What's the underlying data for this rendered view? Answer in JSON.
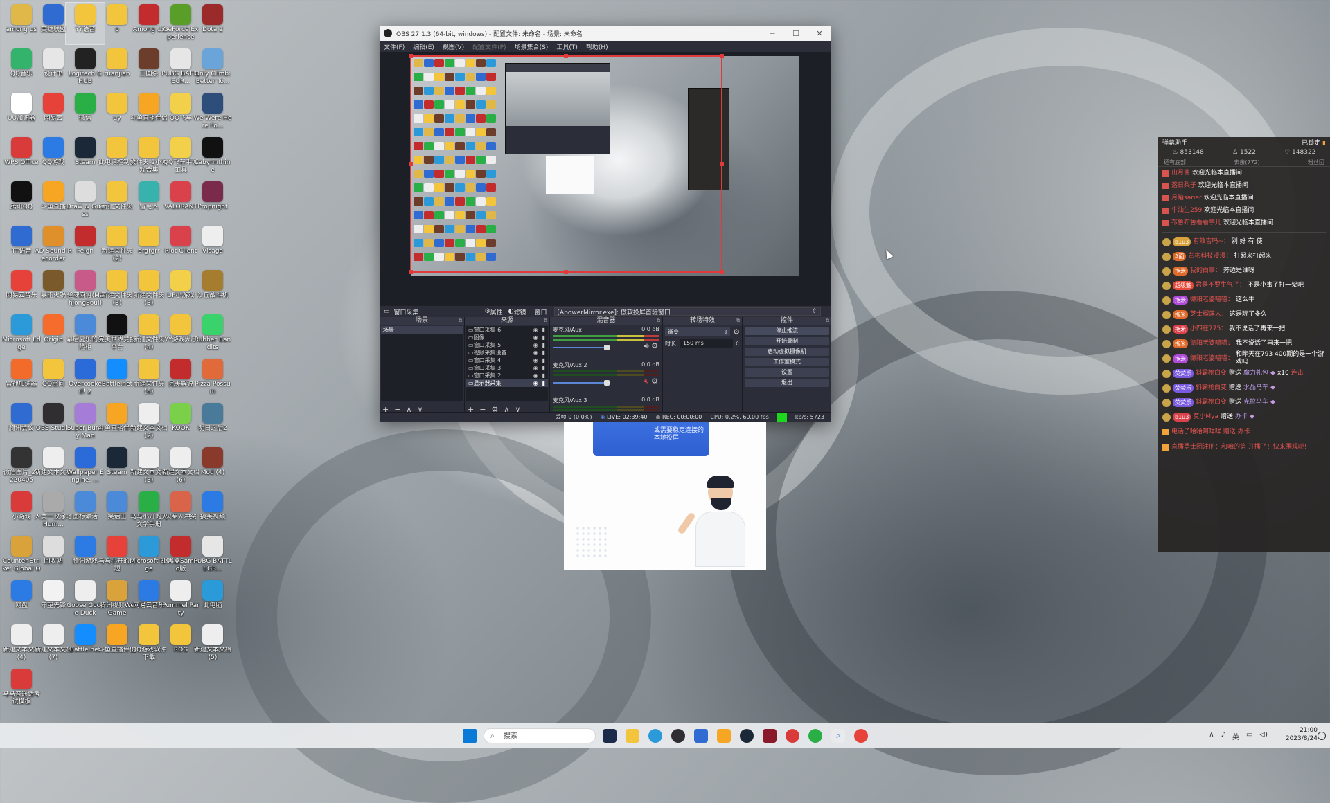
{
  "desktop": {
    "icons": [
      {
        "label": "among us",
        "color": "#e0b84a"
      },
      {
        "label": "英雄联盟",
        "color": "#2f6bd0"
      },
      {
        "label": "YY语音",
        "color": "#f2c53d"
      },
      {
        "label": "o",
        "color": "#f2c53d"
      },
      {
        "label": "Among Us",
        "color": "#c32c2c"
      },
      {
        "label": "GeForce Experience",
        "color": "#5a9e2a"
      },
      {
        "label": "Dota 2",
        "color": "#9b2b2b"
      },
      {
        "label": "QQ音乐",
        "color": "#33b36b"
      },
      {
        "label": "设计书",
        "color": "#e6e6e6"
      },
      {
        "label": "Logitech G HUB",
        "color": "#222222"
      },
      {
        "label": "ruanjian",
        "color": "#f2c53d"
      },
      {
        "label": "三国杀",
        "color": "#6b3d2a"
      },
      {
        "label": "PUBG BATTLEGR...",
        "color": "#e6e6e6"
      },
      {
        "label": "Only Climb: Better To...",
        "color": "#6aa4d8"
      },
      {
        "label": "UU加速器",
        "color": "#ffffff"
      },
      {
        "label": "网易云",
        "color": "#e6423a"
      },
      {
        "label": "微信",
        "color": "#2aae46"
      },
      {
        "label": "uy",
        "color": "#f2c53d"
      },
      {
        "label": "斗鱼直播伴侣",
        "color": "#f6a623"
      },
      {
        "label": "QQ飞车",
        "color": "#f2d04a"
      },
      {
        "label": "We Were Here Fo...",
        "color": "#2d4d7a"
      },
      {
        "label": "WPS Office",
        "color": "#d93b3b"
      },
      {
        "label": "QQ游戏",
        "color": "#2c7be5"
      },
      {
        "label": "Steam",
        "color": "#1b2838"
      },
      {
        "label": "此电脑控制器",
        "color": "#f2c53d"
      },
      {
        "label": "文件夹-2小游戏合集",
        "color": "#f2c53d"
      },
      {
        "label": "QQ飞车手游工具",
        "color": "#f2d04a"
      },
      {
        "label": "Labyrinthine",
        "color": "#111111"
      },
      {
        "label": "腾讯QQ",
        "color": "#111111"
      },
      {
        "label": "斗鱼直播",
        "color": "#f6a623"
      },
      {
        "label": "Draw & Guess",
        "color": "#dddddd"
      },
      {
        "label": "新建文件夹",
        "color": "#f2c53d"
      },
      {
        "label": "雷电入",
        "color": "#38b2ac"
      },
      {
        "label": "VALORANT",
        "color": "#d9414b"
      },
      {
        "label": "Propnight",
        "color": "#7a2a4a"
      },
      {
        "label": "TT语音",
        "color": "#2f6bd0"
      },
      {
        "label": "AD Sound Recorder",
        "color": "#e0902a"
      },
      {
        "label": "Feign",
        "color": "#c32c2c"
      },
      {
        "label": "新建文件夹 (2)",
        "color": "#f2c53d"
      },
      {
        "label": "ergrgrr",
        "color": "#f2c53d"
      },
      {
        "label": "Riot Client",
        "color": "#d9414b"
      },
      {
        "label": "Visage",
        "color": "#eeeeee"
      },
      {
        "label": "网易云音乐",
        "color": "#e6423a"
      },
      {
        "label": "暴雨火锅",
        "color": "#7a5a2a"
      },
      {
        "label": "雀魂麻将(MahjongSoul)",
        "color": "#c85a8a"
      },
      {
        "label": "新建文件夹 (3)",
        "color": "#f2c53d"
      },
      {
        "label": "新建文件夹 (3)",
        "color": "#f2c53d"
      },
      {
        "label": "UP小游戏",
        "color": "#f2d04a"
      },
      {
        "label": "沙丘战斗机",
        "color": "#a67c2e"
      },
      {
        "label": "Microsoft Edge",
        "color": "#2c9ad9"
      },
      {
        "label": "Origin",
        "color": "#f56c2d"
      },
      {
        "label": "幕后夏乐的保险柜",
        "color": "#4a8ad9"
      },
      {
        "label": "完美世界竞技平台",
        "color": "#111111"
      },
      {
        "label": "新建文件夹 (4)",
        "color": "#f2c53d"
      },
      {
        "label": "YY游戏大厅",
        "color": "#f2c53d"
      },
      {
        "label": "Rubber Bandits",
        "color": "#3ad36b"
      },
      {
        "label": "雷神加速器",
        "color": "#f26b2a"
      },
      {
        "label": "QQ空间",
        "color": "#f2c53d"
      },
      {
        "label": "Overcooked! 2",
        "color": "#2a6ad9"
      },
      {
        "label": "Battle.net",
        "color": "#148eff"
      },
      {
        "label": "新建文件夹 (6)",
        "color": "#f2c53d"
      },
      {
        "label": "完美解说",
        "color": "#c32c2c"
      },
      {
        "label": "Pizza Possum",
        "color": "#e06a3a"
      },
      {
        "label": "腾讯会议",
        "color": "#2f6bd0"
      },
      {
        "label": "OBS Studio",
        "color": "#302e31"
      },
      {
        "label": "Super Bunny Man",
        "color": "#a67cd9"
      },
      {
        "label": "斗鱼直播伴侣",
        "color": "#f6a623"
      },
      {
        "label": "新建文本文档 (2)",
        "color": "#eeeeee"
      },
      {
        "label": "KOOK",
        "color": "#7bd04a"
      },
      {
        "label": "明日之后2",
        "color": "#4a7a9a"
      },
      {
        "label": "微信图片_20220405",
        "color": "#333333"
      },
      {
        "label": "新建文本文档",
        "color": "#eeeeee"
      },
      {
        "label": "Wallpaper Engine: ...",
        "color": "#2a6ad9"
      },
      {
        "label": "Steam",
        "color": "#1b2838"
      },
      {
        "label": "新建文本文档 (3)",
        "color": "#eeeeee"
      },
      {
        "label": "新建文本文档 (6)",
        "color": "#eeeeee"
      },
      {
        "label": "Mod (4)",
        "color": "#8a3a2a"
      },
      {
        "label": "小游戏",
        "color": "#d93b3b"
      },
      {
        "label": "人类一败涂地 Hum...",
        "color": "#aaaaaa"
      },
      {
        "label": "图标激活",
        "color": "#4a8ad9"
      },
      {
        "label": "笑话王",
        "color": "#4a8ad9"
      },
      {
        "label": "马马小开的天文学手册",
        "color": "#2aae46"
      },
      {
        "label": "火柴人冲突",
        "color": "#d9644a"
      },
      {
        "label": "搞笑视频",
        "color": "#2c7be5"
      },
      {
        "label": "Counter-Strike: Global Off...",
        "color": "#d9a23a"
      },
      {
        "label": "回收站",
        "color": "#dddddd"
      },
      {
        "label": "腾讯游戏",
        "color": "#2c7be5"
      },
      {
        "label": "马马小开的问题",
        "color": "#e6423a"
      },
      {
        "label": "Microsoft Edge",
        "color": "#2c9ad9"
      },
      {
        "label": "小黑盒SamPro版",
        "color": "#c32c2c"
      },
      {
        "label": "PUBG BATTLEGR...",
        "color": "#e6e6e6"
      },
      {
        "label": "网盘",
        "color": "#2c7be5"
      },
      {
        "label": "守望先锋",
        "color": "#f2f2f2"
      },
      {
        "label": "Goose Goose Duck",
        "color": "#eeeeee"
      },
      {
        "label": "腾讯视频WeGame",
        "color": "#d9a23a"
      },
      {
        "label": "网易云音乐",
        "color": "#2c7be5"
      },
      {
        "label": "Pummel Party",
        "color": "#eeeeee"
      },
      {
        "label": "此电脑",
        "color": "#2a9ad9"
      },
      {
        "label": "新建文本文档 (4)",
        "color": "#eeeeee"
      },
      {
        "label": "新建文本文档 (7)",
        "color": "#eeeeee"
      },
      {
        "label": "Battle.net",
        "color": "#148eff"
      },
      {
        "label": "斗鱼直播伴侣",
        "color": "#f6a623"
      },
      {
        "label": "QQ游戏软件下载",
        "color": "#f2c53d"
      },
      {
        "label": "ROG",
        "color": "#f2c53d"
      },
      {
        "label": "新建文本文档 (5)",
        "color": "#eeeeee"
      },
      {
        "label": "马马普通话考试模板",
        "color": "#d93b3b"
      }
    ]
  },
  "obs": {
    "title": "OBS 27.1.3 (64-bit, windows) - 配置文件: 未命名 - 场景: 未命名",
    "menu": [
      "文件(F)",
      "编辑(E)",
      "视图(V)",
      "配置文件(P)",
      "场景集合(S)",
      "工具(T)",
      "帮助(H)"
    ],
    "source_toolbar": {
      "current": "窗口采集",
      "properties": "属性",
      "filters": "滤镜",
      "window_label": "窗口",
      "window_value": "[ApowerMirror.exe]: 傲软投屏首验窗口"
    },
    "docks": {
      "scenes": {
        "title": "场景",
        "items": [
          "场景"
        ]
      },
      "sources": {
        "title": "来源",
        "items": [
          "窗口采集 6",
          "图像",
          "窗口采集 5",
          "视频采集设备",
          "窗口采集 4",
          "窗口采集 3",
          "窗口采集 2",
          "显示器采集"
        ]
      },
      "mixer": {
        "title": "混音器",
        "channels": [
          {
            "name": "麦克风/Aux",
            "db": "0.0 dB",
            "level": 0.78,
            "muted": false
          },
          {
            "name": "麦克风/Aux 2",
            "db": "0.0 dB",
            "level": 0.78,
            "muted": true
          },
          {
            "name": "麦克风/Aux 3",
            "db": "0.0 dB",
            "level": 0.78,
            "muted": true
          }
        ]
      },
      "transitions": {
        "title": "转场特效",
        "type": "渐变",
        "duration_label": "时长",
        "duration": "150 ms"
      },
      "controls": {
        "title": "控件",
        "buttons": [
          "停止推流",
          "开始录制",
          "启动虚拟摄像机",
          "工作室模式",
          "设置",
          "退出"
        ]
      }
    },
    "status": {
      "dropped": "丢帧 0 (0.0%)",
      "live": "LIVE: 02:39:40",
      "rec": "REC: 00:00:00",
      "cpu": "CPU: 0.2%, 60.00 fps",
      "kbps": "kb/s: 5723"
    }
  },
  "floating_image": {
    "banner_text": "或需要稳定连接的本地投屏"
  },
  "danmu": {
    "title": "弹幕助手",
    "lock": "已锁定",
    "stats": [
      "853148",
      "1522",
      "148322"
    ],
    "tabs": [
      "还有底部",
      "表亲(772)",
      "粉丝团"
    ],
    "welcome": [
      {
        "user": "山月酱",
        "text": "欢迎光临本直播间"
      },
      {
        "user": "落日梨子",
        "text": "欢迎光临本直播间"
      },
      {
        "user": "月踏sarier",
        "text": "欢迎光临本直播间"
      },
      {
        "user": "牛油生259",
        "text": "欢迎光临本直播间"
      },
      {
        "user": "布鲁布鲁看看事儿",
        "text": "欢迎光临本直播间"
      }
    ],
    "messages": [
      {
        "badge": "b1u3",
        "badge_color": "#d9a23a",
        "user": "有效吉吗~：",
        "text": "别 好 有 使"
      },
      {
        "badge": "A面",
        "badge_color": "#e06a2a",
        "user": "彭彬科技漫漫：",
        "text": "打起来打起来"
      },
      {
        "badge": "拖米",
        "badge_color": "#e06a2a",
        "user": "我的白事：",
        "text": "旁边是谁呀"
      },
      {
        "badge": "超级魅",
        "badge_color": "#e64a3a",
        "user": "君是不要生气了：",
        "text": "不是小事了打一架吧"
      },
      {
        "badge": "拖米",
        "badge_color": "#b04ad9",
        "user": "德阳老婆喵喵：",
        "text": "这么牛"
      },
      {
        "badge": "拖米",
        "badge_color": "#e06a2a",
        "user": "芝士榴莲人：",
        "text": "这是玩了多久"
      },
      {
        "badge": "拖米",
        "badge_color": "#d9414b",
        "user": "小四在775：",
        "text": "我不说话了再来一把"
      },
      {
        "badge": "拖米",
        "badge_color": "#e06a2a",
        "user": "德阳老婆喵喵：",
        "text": "我不说话了再来一把"
      },
      {
        "badge": "拖米",
        "badge_color": "#b04ad9",
        "user": "德阳老婆喵喵：",
        "text": "和昨天在793 400期的是一个游戏吗"
      }
    ],
    "gifts": [
      {
        "badge": "荧荧乐",
        "user": "斜霸枪白变",
        "action": "赠送",
        "item": "魔力礼包",
        "count": "x10",
        "extra": "连击"
      },
      {
        "badge": "荧荧乐",
        "user": "斜霸枪白变",
        "action": "赠送",
        "item": "水晶马车",
        "count": "",
        "extra": ""
      },
      {
        "badge": "荧荧乐",
        "user": "斜霸枪白变",
        "action": "赠送",
        "item": "克拉马车",
        "count": "",
        "extra": ""
      },
      {
        "badge": "b1u3",
        "user": "莫小Mya",
        "action": "赠送",
        "item": "办卡",
        "count": "",
        "extra": ""
      }
    ],
    "footer": [
      "电话子哈哈呵咩咩 赠送 办卡",
      "直播勇士团注册：和咱的第 开播了！快来围观吧!"
    ]
  },
  "taskbar": {
    "search_placeholder": "搜索",
    "time": "21:00",
    "date": "2023/8/24",
    "ime": "英"
  }
}
